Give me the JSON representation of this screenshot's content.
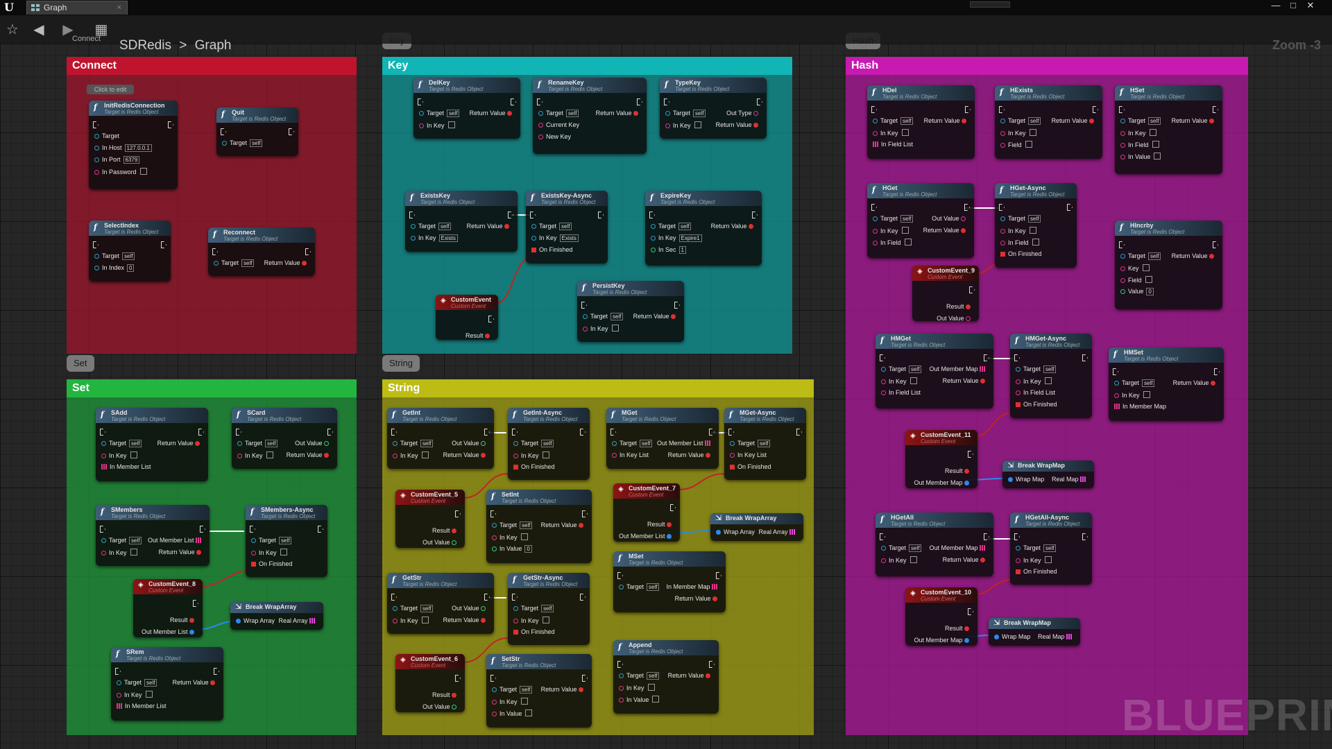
{
  "window": {
    "tab_label": "Graph",
    "tab_close": "×",
    "controls": [
      "—",
      "□",
      "✕"
    ]
  },
  "toolbar": {
    "breadcrumb": [
      "SDRedis",
      "Graph"
    ],
    "separator": ">",
    "zoom": "Zoom -3",
    "ghost_label": "Connect"
  },
  "watermark": "BLUEPRINT",
  "colors": {
    "connect": "#a3162e",
    "key": "#0f9b9b",
    "hash": "#b3189e",
    "set": "#1f9e3b",
    "string": "#a9a812"
  },
  "comments": {
    "connect": {
      "title": "Connect"
    },
    "key": {
      "title": "Key",
      "bubble": "Key"
    },
    "hash": {
      "title": "Hash",
      "bubble": "Hash"
    },
    "set": {
      "title": "Set",
      "bubble": "Set"
    },
    "string": {
      "title": "String",
      "bubble": "String"
    }
  },
  "click_to_edit": "Click to edit",
  "nodes": {
    "init": {
      "title": "InitRedisConnection",
      "sub": "Target is Redis Object",
      "p": [
        "Target",
        "In Host",
        "In Port",
        "In Password"
      ],
      "v": [
        "self",
        "127.0.0.1",
        "6379"
      ]
    },
    "quit": {
      "title": "Quit",
      "sub": "Target is Redis Object",
      "p": [
        "Target"
      ],
      "v": [
        "self"
      ]
    },
    "selectindex": {
      "title": "SelectIndex",
      "sub": "Target is Redis Object",
      "p": [
        "Target",
        "In Index"
      ],
      "v": [
        "self",
        "0"
      ]
    },
    "reconnect": {
      "title": "Reconnect",
      "sub": "Target is Redis Object",
      "p": [
        "Target",
        "Return Value"
      ],
      "v": [
        "self"
      ]
    },
    "delkey": {
      "title": "DelKey",
      "sub": "Target is Redis Object",
      "p": [
        "Target",
        "Return Value",
        "In Key"
      ],
      "v": [
        "self"
      ]
    },
    "renamekey": {
      "title": "RenameKey",
      "sub": "Target is Redis Object",
      "p": [
        "Target",
        "Return Value",
        "Current Key",
        "New Key"
      ],
      "v": [
        "self"
      ]
    },
    "typekey": {
      "title": "TypeKey",
      "sub": "Target is Redis Object",
      "p": [
        "Target",
        "Out Type",
        "Return Value",
        "In Key"
      ],
      "v": [
        "self"
      ]
    },
    "existskey": {
      "title": "ExistsKey",
      "sub": "Target is Redis Object",
      "p": [
        "Target",
        "Return Value",
        "In Key"
      ],
      "v": [
        "self",
        "Exists"
      ]
    },
    "existskeyasync": {
      "title": "ExistsKey-Async",
      "sub": "Target is Redis Object",
      "p": [
        "Target",
        "In Key",
        "On Finished"
      ],
      "v": [
        "self",
        "Exists"
      ]
    },
    "expirekey": {
      "title": "ExpireKey",
      "sub": "Target is Redis Object",
      "p": [
        "Target",
        "Return Value",
        "In Key",
        "In Sec"
      ],
      "v": [
        "self",
        "Expire1",
        "1"
      ]
    },
    "customevent": {
      "title": "CustomEvent",
      "sub": "Custom Event",
      "p": [
        "Result"
      ]
    },
    "persistkey": {
      "title": "PersistKey",
      "sub": "Target is Redis Object",
      "p": [
        "Target",
        "Return Value",
        "In Key"
      ],
      "v": [
        "self"
      ]
    },
    "hdel": {
      "title": "HDel",
      "sub": "Target is Redis Object",
      "p": [
        "Target",
        "Return Value",
        "In Key",
        "In Field List"
      ],
      "v": [
        "self"
      ]
    },
    "hexists": {
      "title": "HExists",
      "sub": "Target is Redis Object",
      "p": [
        "Target",
        "Return Value",
        "In Key",
        "Field"
      ],
      "v": [
        "self"
      ]
    },
    "hset": {
      "title": "HSet",
      "sub": "Target is Redis Object",
      "p": [
        "Target",
        "Return Value",
        "In Key",
        "In Field",
        "In Value"
      ],
      "v": [
        "self"
      ]
    },
    "hget": {
      "title": "HGet",
      "sub": "Target is Redis Object",
      "p": [
        "Target",
        "Out Value",
        "In Key",
        "Return Value",
        "In Field"
      ],
      "v": [
        "self"
      ]
    },
    "hgetasync": {
      "title": "HGet-Async",
      "sub": "Target is Redis Object",
      "p": [
        "Target",
        "In Key",
        "In Field",
        "On Finished"
      ],
      "v": [
        "self"
      ]
    },
    "hincrby": {
      "title": "HIncrby",
      "sub": "Target is Redis Object",
      "p": [
        "Target",
        "Return Value",
        "Key",
        "Field",
        "Value"
      ],
      "v": [
        "self",
        "0"
      ]
    },
    "ce9": {
      "title": "CustomEvent_9",
      "sub": "Custom Event",
      "p": [
        "Result",
        "Out Value"
      ]
    },
    "hmget": {
      "title": "HMGet",
      "sub": "Target is Redis Object",
      "p": [
        "Target",
        "Out Member Map",
        "In Key",
        "Return Value",
        "In Field List"
      ],
      "v": [
        "self"
      ]
    },
    "hmgetasync": {
      "title": "HMGet-Async",
      "sub": "Target is Redis Object",
      "p": [
        "Target",
        "In Key",
        "In Field List",
        "On Finished"
      ],
      "v": [
        "self"
      ]
    },
    "hmset": {
      "title": "HMSet",
      "sub": "Target is Redis Object",
      "p": [
        "Target",
        "Return Value",
        "In Key",
        "In Member Map"
      ],
      "v": [
        "self"
      ]
    },
    "ce11": {
      "title": "CustomEvent_11",
      "sub": "Custom Event",
      "p": [
        "Result",
        "Out Member Map"
      ]
    },
    "bwm1": {
      "title": "Break WrapMap",
      "p": [
        "Wrap Map",
        "Real Map"
      ]
    },
    "hgetall": {
      "title": "HGetAll",
      "sub": "Target is Redis Object",
      "p": [
        "Target",
        "Out Member Map",
        "In Key",
        "Return Value"
      ],
      "v": [
        "self"
      ]
    },
    "hgetallasync": {
      "title": "HGetAll-Async",
      "sub": "Target is Redis Object",
      "p": [
        "Target",
        "In Key",
        "On Finished"
      ],
      "v": [
        "self"
      ]
    },
    "ce10": {
      "title": "CustomEvent_10",
      "sub": "Custom Event",
      "p": [
        "Result",
        "Out Member Map"
      ]
    },
    "bwm2": {
      "title": "Break WrapMap",
      "p": [
        "Wrap Map",
        "Real Map"
      ]
    },
    "sadd": {
      "title": "SAdd",
      "sub": "Target is Redis Object",
      "p": [
        "Target",
        "Return Value",
        "In Key",
        "In Member List"
      ],
      "v": [
        "self"
      ]
    },
    "scard": {
      "title": "SCard",
      "sub": "Target is Redis Object",
      "p": [
        "Target",
        "Out Value",
        "In Key",
        "Return Value"
      ],
      "v": [
        "self"
      ]
    },
    "smembers": {
      "title": "SMembers",
      "sub": "Target is Redis Object",
      "p": [
        "Target",
        "Out Member List",
        "In Key",
        "Return Value"
      ],
      "v": [
        "self"
      ]
    },
    "smembersasync": {
      "title": "SMembers-Async",
      "sub": "Target is Redis Object",
      "p": [
        "Target",
        "In Key",
        "On Finished"
      ],
      "v": [
        "self"
      ]
    },
    "ce8": {
      "title": "CustomEvent_8",
      "sub": "Custom Event",
      "p": [
        "Result",
        "Out Member List"
      ]
    },
    "bwa1": {
      "title": "Break WrapArray",
      "p": [
        "Wrap Array",
        "Real Array"
      ]
    },
    "srem": {
      "title": "SRem",
      "sub": "Target is Redis Object",
      "p": [
        "Target",
        "Return Value",
        "In Key",
        "In Member List"
      ],
      "v": [
        "self"
      ]
    },
    "getint": {
      "title": "GetInt",
      "sub": "Target is Redis Object",
      "p": [
        "Target",
        "Out Value",
        "In Key",
        "Return Value"
      ],
      "v": [
        "self"
      ]
    },
    "getintasync": {
      "title": "GetInt-Async",
      "sub": "Target is Redis Object",
      "p": [
        "Target",
        "In Key",
        "On Finished"
      ],
      "v": [
        "self"
      ]
    },
    "mget": {
      "title": "MGet",
      "sub": "Target is Redis Object",
      "p": [
        "Target",
        "Out Member List",
        "In Key List",
        "Return Value"
      ],
      "v": [
        "self"
      ]
    },
    "mgetasync": {
      "title": "MGet-Async",
      "sub": "Target is Redis Object",
      "p": [
        "Target",
        "In Key List",
        "On Finished"
      ],
      "v": [
        "self"
      ]
    },
    "ce5": {
      "title": "CustomEvent_5",
      "sub": "Custom Event",
      "p": [
        "Result",
        "Out Value"
      ]
    },
    "setint": {
      "title": "SetInt",
      "sub": "Target is Redis Object",
      "p": [
        "Target",
        "Return Value",
        "In Key",
        "In Value"
      ],
      "v": [
        "self",
        "0"
      ]
    },
    "ce7": {
      "title": "CustomEvent_7",
      "sub": "Custom Event",
      "p": [
        "Result",
        "Out Member List"
      ]
    },
    "bwa2": {
      "title": "Break WrapArray",
      "p": [
        "Wrap Array",
        "Real Array"
      ]
    },
    "mset": {
      "title": "MSet",
      "sub": "Target is Redis Object",
      "p": [
        "Target",
        "In Member Map",
        "Return Value"
      ],
      "v": [
        "self"
      ]
    },
    "getstr": {
      "title": "GetStr",
      "sub": "Target is Redis Object",
      "p": [
        "Target",
        "Out Value",
        "In Key",
        "Return Value"
      ],
      "v": [
        "self"
      ]
    },
    "getstrasync": {
      "title": "GetStr-Async",
      "sub": "Target is Redis Object",
      "p": [
        "Target",
        "In Key",
        "On Finished"
      ],
      "v": [
        "self"
      ]
    },
    "ce6": {
      "title": "CustomEvent_6",
      "sub": "Custom Event",
      "p": [
        "Result",
        "Out Value"
      ]
    },
    "setstr": {
      "title": "SetStr",
      "sub": "Target is Redis Object",
      "p": [
        "Target",
        "Return Value",
        "In Key",
        "In Value"
      ],
      "v": [
        "self"
      ]
    },
    "append": {
      "title": "Append",
      "sub": "Target is Redis Object",
      "p": [
        "Target",
        "Return Value",
        "In Key",
        "In Value"
      ],
      "v": [
        "self"
      ]
    }
  }
}
